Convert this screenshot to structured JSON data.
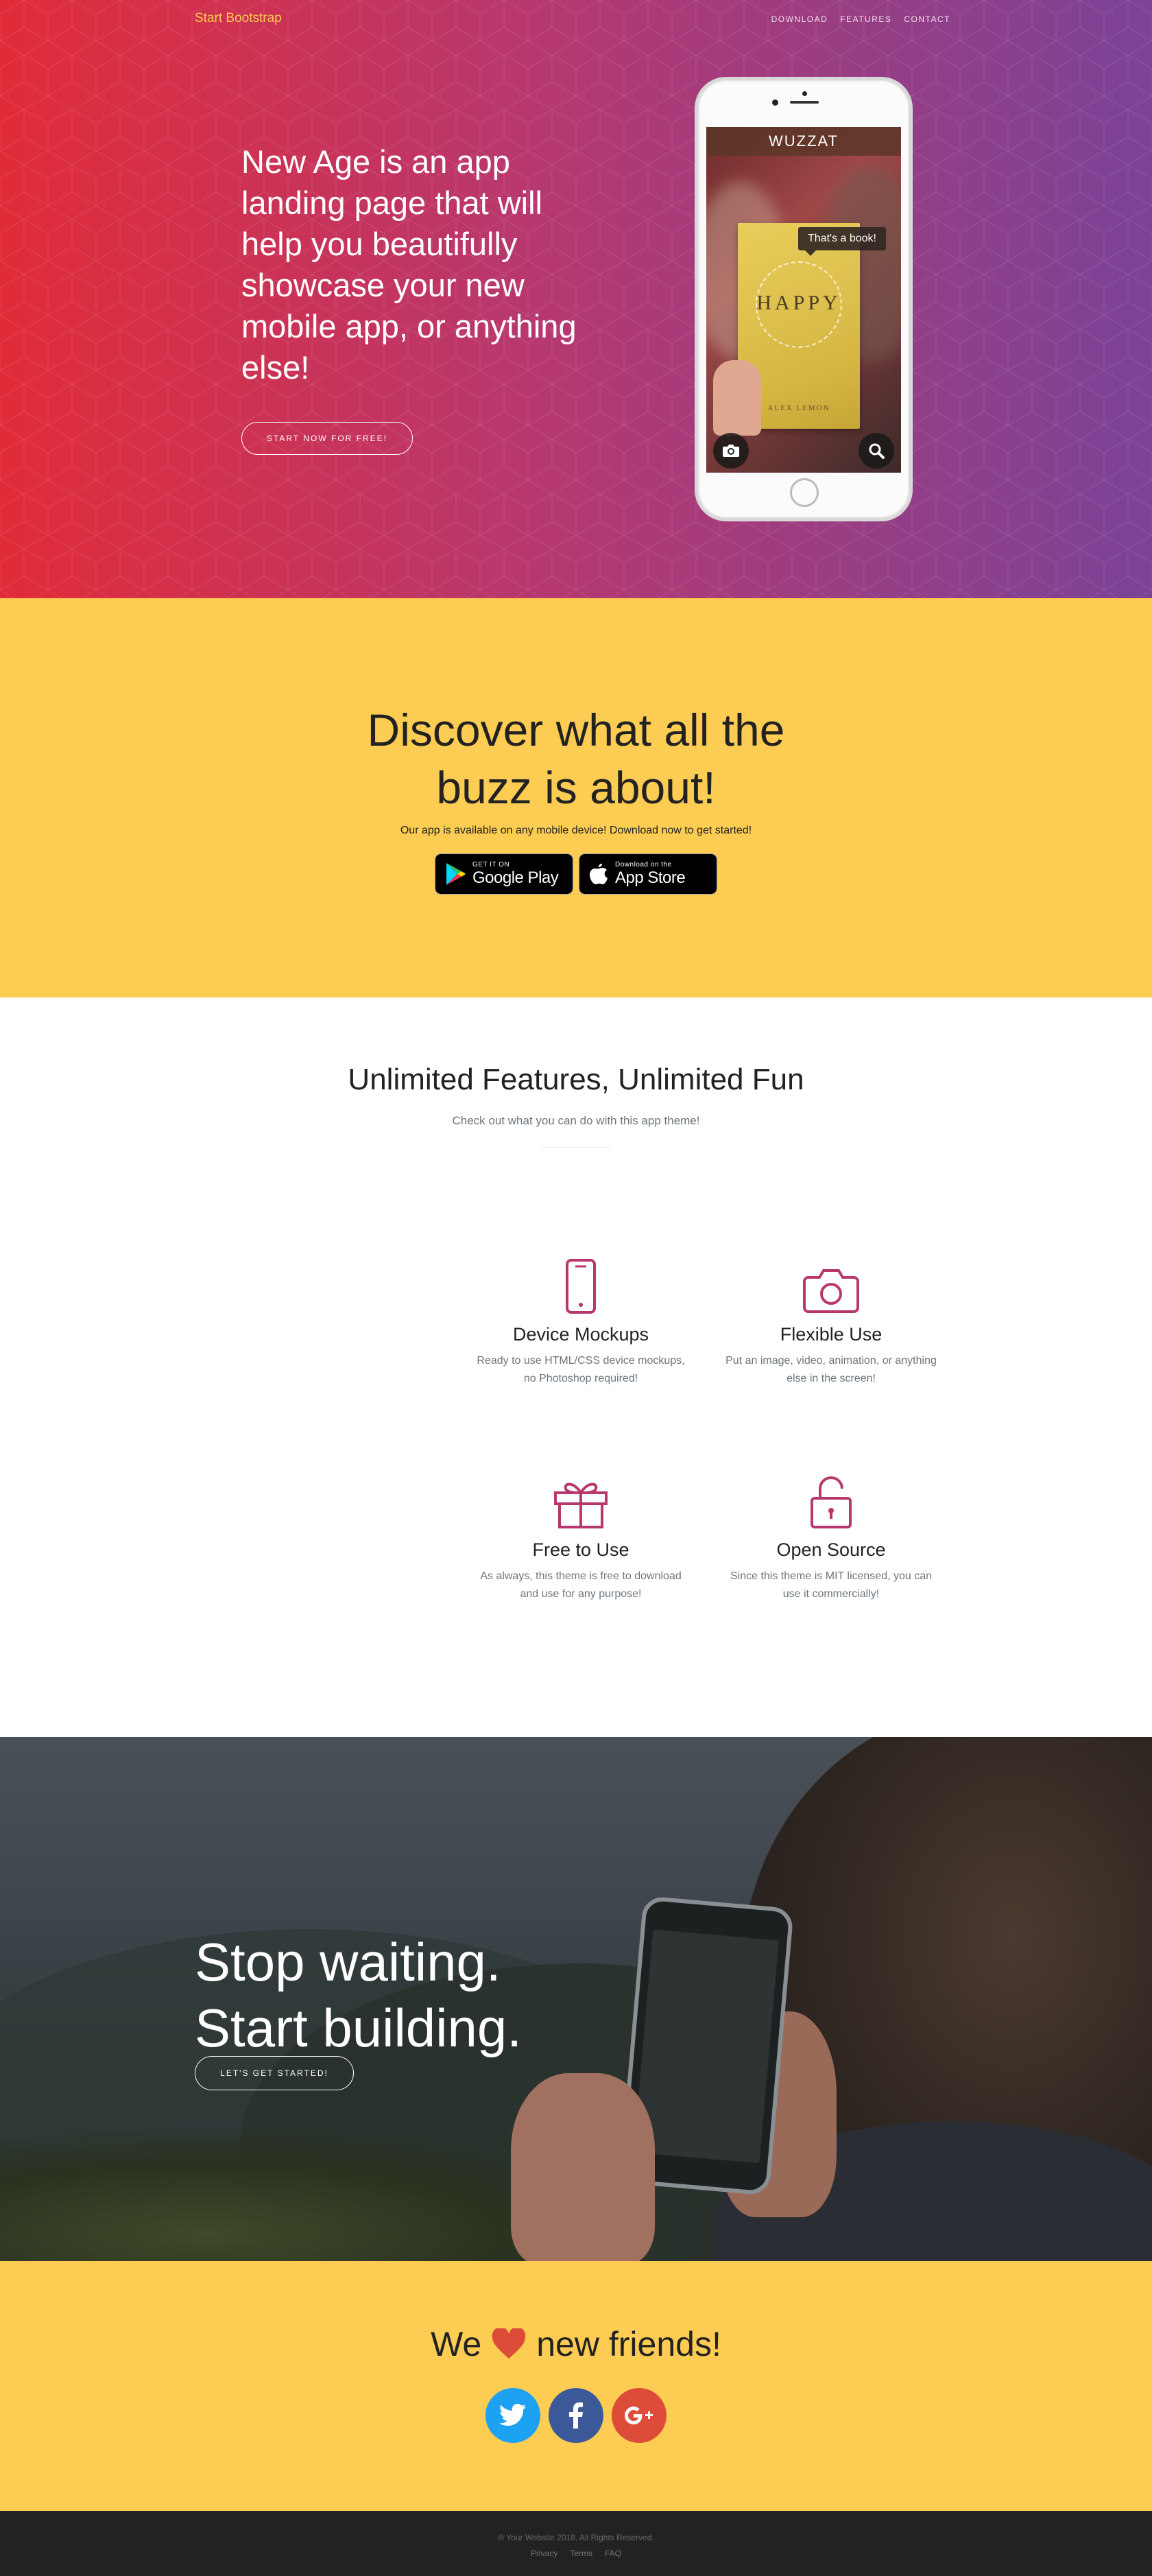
{
  "nav": {
    "brand": "Start Bootstrap",
    "links": [
      "DOWNLOAD",
      "FEATURES",
      "CONTACT"
    ]
  },
  "hero": {
    "headline": "New Age is an app landing page that will help you beautifully showcase your new mobile app, or anything else!",
    "button": "START NOW FOR FREE!"
  },
  "phone": {
    "app_name": "WUZZAT",
    "bubble": "That's a book!",
    "book_title": "HAPPY",
    "book_author": "ALEX LEMON"
  },
  "download": {
    "heading_line1": "Discover what all the",
    "heading_line2": "buzz is about!",
    "text": "Our app is available on any mobile device! Download now to get started!",
    "google_small": "GET IT ON",
    "google_big": "Google Play",
    "apple_small": "Download on the",
    "apple_big": "App Store"
  },
  "features": {
    "heading": "Unlimited Features, Unlimited Fun",
    "subheading": "Check out what you can do with this app theme!",
    "items": [
      {
        "icon": "screen-smartphone-icon",
        "title": "Device Mockups",
        "text": "Ready to use HTML/CSS device mockups, no Photoshop required!"
      },
      {
        "icon": "camera-icon",
        "title": "Flexible Use",
        "text": "Put an image, video, animation, or anything else in the screen!"
      },
      {
        "icon": "present-icon",
        "title": "Free to Use",
        "text": "As always, this theme is free to download and use for any purpose!"
      },
      {
        "icon": "lock-open-icon",
        "title": "Open Source",
        "text": "Since this theme is MIT licensed, you can use it commercially!"
      }
    ],
    "accent": "#b8386e"
  },
  "cta": {
    "line1": "Stop waiting.",
    "line2": "Start building.",
    "button": "LET'S GET STARTED!"
  },
  "contact": {
    "we": "We",
    "friends": "new friends!",
    "social": [
      {
        "name": "twitter",
        "color": "#1da1f2"
      },
      {
        "name": "facebook",
        "color": "#3b5998"
      },
      {
        "name": "google-plus",
        "color": "#dd4b39"
      }
    ]
  },
  "footer": {
    "copyright": "© Your Website 2018. All Rights Reserved.",
    "links": [
      "Privacy",
      "Terms",
      "FAQ"
    ]
  },
  "colors": {
    "brand_yellow": "#fdcc52",
    "hero_start": "#e12c38",
    "hero_end": "#7b4397",
    "footer_bg": "#222222"
  }
}
